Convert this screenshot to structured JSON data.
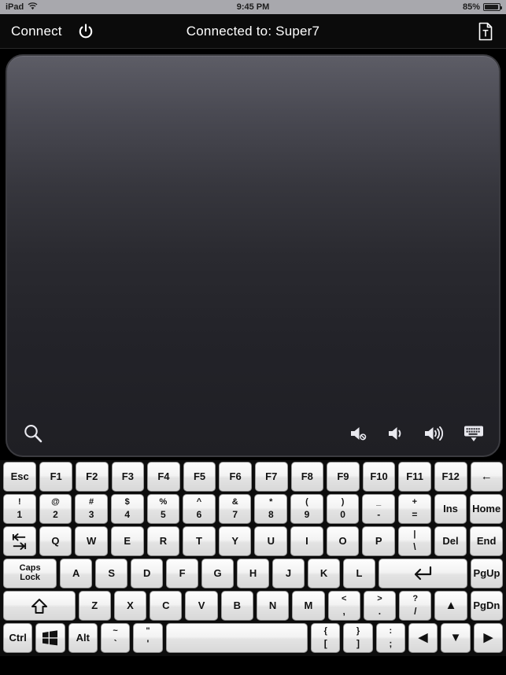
{
  "status_bar": {
    "device": "iPad",
    "wifi_icon": "wifi-icon",
    "time": "9:45 PM",
    "battery_percent": "85%",
    "battery_level": 85
  },
  "nav_bar": {
    "connect_label": "Connect",
    "power_icon": "power-icon",
    "title": "Connected to: Super7",
    "document_icon": "text-document-icon"
  },
  "trackpad": {
    "search_icon": "search-icon",
    "volume_mute_icon": "volume-mute-icon",
    "volume_down_icon": "volume-down-icon",
    "volume_up_icon": "volume-up-icon",
    "hide_keyboard_icon": "hide-keyboard-icon"
  },
  "keyboard": {
    "rows": [
      {
        "name": "function-row",
        "keys": [
          {
            "name": "key-esc",
            "label": "Esc",
            "class": "w-esc"
          },
          {
            "name": "key-f1",
            "label": "F1"
          },
          {
            "name": "key-f2",
            "label": "F2"
          },
          {
            "name": "key-f3",
            "label": "F3"
          },
          {
            "name": "key-f4",
            "label": "F4"
          },
          {
            "name": "key-f5",
            "label": "F5"
          },
          {
            "name": "key-f6",
            "label": "F6"
          },
          {
            "name": "key-f7",
            "label": "F7"
          },
          {
            "name": "key-f8",
            "label": "F8"
          },
          {
            "name": "key-f9",
            "label": "F9"
          },
          {
            "name": "key-f10",
            "label": "F10"
          },
          {
            "name": "key-f11",
            "label": "F11"
          },
          {
            "name": "key-f12",
            "label": "F12"
          },
          {
            "name": "key-backspace",
            "label": "←",
            "glyph": true
          }
        ]
      },
      {
        "name": "number-row",
        "keys": [
          {
            "name": "key-1",
            "top": "!",
            "bottom": "1"
          },
          {
            "name": "key-2",
            "top": "@",
            "bottom": "2"
          },
          {
            "name": "key-3",
            "top": "#",
            "bottom": "3"
          },
          {
            "name": "key-4",
            "top": "$",
            "bottom": "4"
          },
          {
            "name": "key-5",
            "top": "%",
            "bottom": "5"
          },
          {
            "name": "key-6",
            "top": "^",
            "bottom": "6"
          },
          {
            "name": "key-7",
            "top": "&",
            "bottom": "7"
          },
          {
            "name": "key-8",
            "top": "*",
            "bottom": "8"
          },
          {
            "name": "key-9",
            "top": "(",
            "bottom": "9"
          },
          {
            "name": "key-0",
            "top": ")",
            "bottom": "0"
          },
          {
            "name": "key-minus",
            "top": "_",
            "bottom": "-"
          },
          {
            "name": "key-equals",
            "top": "+",
            "bottom": "="
          },
          {
            "name": "key-ins",
            "label": "Ins"
          },
          {
            "name": "key-home",
            "label": "Home"
          }
        ]
      },
      {
        "name": "qwerty-row",
        "keys": [
          {
            "name": "key-tab",
            "label": "tab",
            "tab_icon": true
          },
          {
            "name": "key-q",
            "label": "Q"
          },
          {
            "name": "key-w",
            "label": "W"
          },
          {
            "name": "key-e",
            "label": "E"
          },
          {
            "name": "key-r",
            "label": "R"
          },
          {
            "name": "key-t",
            "label": "T"
          },
          {
            "name": "key-y",
            "label": "Y"
          },
          {
            "name": "key-u",
            "label": "U"
          },
          {
            "name": "key-i",
            "label": "I"
          },
          {
            "name": "key-o",
            "label": "O"
          },
          {
            "name": "key-p",
            "label": "P"
          },
          {
            "name": "key-backslash",
            "top": "|",
            "bottom": "\\"
          },
          {
            "name": "key-del",
            "label": "Del"
          },
          {
            "name": "key-end",
            "label": "End"
          }
        ]
      },
      {
        "name": "home-row",
        "keys": [
          {
            "name": "key-caps-lock",
            "line1": "Caps",
            "line2": "Lock",
            "class": "w-caps"
          },
          {
            "name": "key-a",
            "label": "A"
          },
          {
            "name": "key-s",
            "label": "S"
          },
          {
            "name": "key-d",
            "label": "D"
          },
          {
            "name": "key-f",
            "label": "F"
          },
          {
            "name": "key-g",
            "label": "G"
          },
          {
            "name": "key-h",
            "label": "H"
          },
          {
            "name": "key-j",
            "label": "J"
          },
          {
            "name": "key-k",
            "label": "K"
          },
          {
            "name": "key-l",
            "label": "L"
          },
          {
            "name": "key-enter",
            "label": "↵",
            "enter_icon": true,
            "class": "w-enter"
          },
          {
            "name": "key-pgup",
            "label": "PgUp"
          }
        ]
      },
      {
        "name": "zxcv-row",
        "keys": [
          {
            "name": "key-shift",
            "label": "⇧",
            "shift_icon": true,
            "class": "w-shift"
          },
          {
            "name": "key-z",
            "label": "Z"
          },
          {
            "name": "key-x",
            "label": "X"
          },
          {
            "name": "key-c",
            "label": "C"
          },
          {
            "name": "key-v",
            "label": "V"
          },
          {
            "name": "key-b",
            "label": "B"
          },
          {
            "name": "key-n",
            "label": "N"
          },
          {
            "name": "key-m",
            "label": "M"
          },
          {
            "name": "key-comma",
            "top": "<",
            "bottom": ","
          },
          {
            "name": "key-period",
            "top": ">",
            "bottom": "."
          },
          {
            "name": "key-slash",
            "top": "?",
            "bottom": "/"
          },
          {
            "name": "key-arrow-up",
            "label": "▲",
            "glyph": true
          },
          {
            "name": "key-pgdn",
            "label": "PgDn"
          }
        ]
      },
      {
        "name": "bottom-row",
        "keys": [
          {
            "name": "key-ctrl",
            "label": "Ctrl"
          },
          {
            "name": "key-windows",
            "label": "",
            "win_icon": true
          },
          {
            "name": "key-alt",
            "label": "Alt"
          },
          {
            "name": "key-grave",
            "top": "~",
            "bottom": "`"
          },
          {
            "name": "key-quote",
            "top": "\"",
            "bottom": "'"
          },
          {
            "name": "key-space",
            "label": "",
            "class": "w-space"
          },
          {
            "name": "key-bracket-left",
            "top": "{",
            "bottom": "["
          },
          {
            "name": "key-bracket-right",
            "top": "}",
            "bottom": "]"
          },
          {
            "name": "key-semicolon",
            "top": ":",
            "bottom": ";"
          },
          {
            "name": "key-arrow-left",
            "label": "◀",
            "glyph": true
          },
          {
            "name": "key-arrow-down",
            "label": "▼",
            "glyph": true
          },
          {
            "name": "key-arrow-right",
            "label": "▶",
            "glyph": true
          }
        ]
      }
    ]
  },
  "colors": {
    "status_bar_bg": "#a8a8ad",
    "nav_bar_bg": "#0b0b0b",
    "keyboard_bg": "#0d0d0d",
    "trackpad_top": "#5d5d66",
    "trackpad_bottom": "#1f1f24",
    "key_face": "#f3f3f3"
  }
}
